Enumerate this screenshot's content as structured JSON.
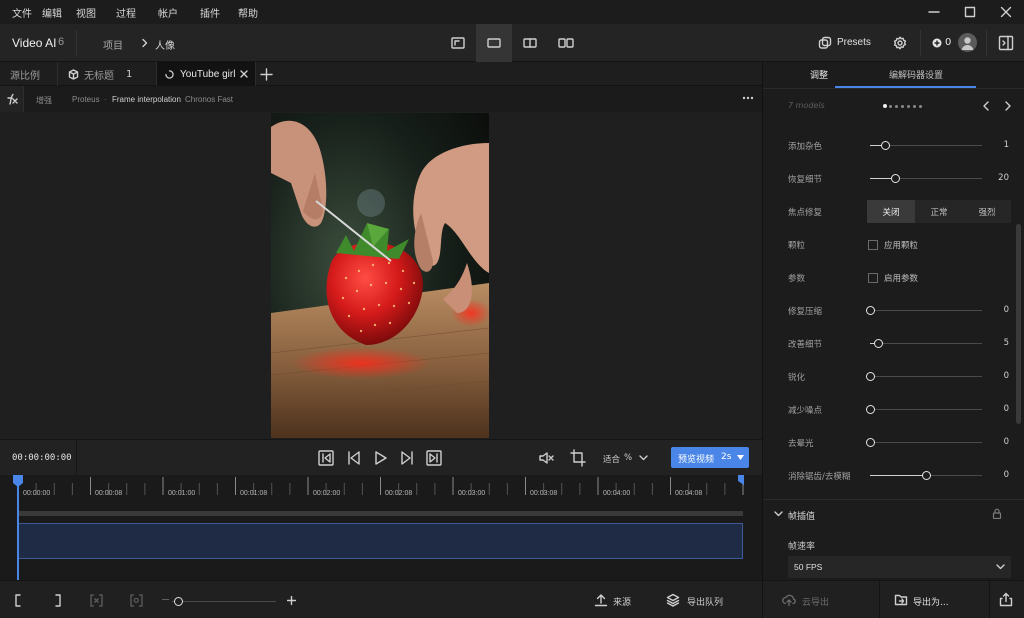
{
  "menu": {
    "items": [
      "文件",
      "编辑",
      "视图",
      "过程",
      "帐户",
      "插件",
      "帮助"
    ]
  },
  "header": {
    "app_name": "Video AI",
    "version": "6",
    "breadcrumb_project": "项目",
    "breadcrumb_current": "人像",
    "presets_label": "Presets",
    "credits": "0"
  },
  "tabs": [
    {
      "label": "源比例"
    },
    {
      "label": "无标题",
      "count": "1"
    },
    {
      "label": "YouTube girl"
    }
  ],
  "fxbar": {
    "enhance": "增强",
    "model": "Proteus",
    "interp": "Frame interpolation",
    "interp_model": "Chronos Fast"
  },
  "transport": {
    "timecode": "00:00:00:00",
    "fit_label": "适合",
    "fit_unit": "%",
    "preview_label": "预览视频",
    "preview_duration": "2s"
  },
  "timeline": {
    "ticks": [
      "00:00:00",
      "00:00:08",
      "00:01:00",
      "00:01:08",
      "00:02:00",
      "00:02:08",
      "00:03:00",
      "00:03:08",
      "00:04:00",
      "00:04:08"
    ]
  },
  "bottom": {
    "source_label": "来源",
    "export_queue_label": "导出队列"
  },
  "right_panel": {
    "tab_adjust": "调整",
    "tab_encoder": "编解码器设置",
    "models_label": "7 models",
    "carousel_dots": 7,
    "carousel_active": 0,
    "sliders_top": [
      {
        "label": "添加杂色",
        "value": "1",
        "fraction": 0.13
      },
      {
        "label": "恢复细节",
        "value": "20",
        "fraction": 0.22
      }
    ],
    "focus_label": "焦点修复",
    "focus_options": [
      "关闭",
      "正常",
      "强烈"
    ],
    "focus_selected": 0,
    "grain": {
      "label": "颗粒",
      "checkbox": "应用颗粒"
    },
    "params": {
      "label": "参数",
      "checkbox": "启用参数"
    },
    "sliders_bottom": [
      {
        "label": "修复压缩",
        "value": "0",
        "fraction": 0.0
      },
      {
        "label": "改善细节",
        "value": "5",
        "fraction": 0.07
      },
      {
        "label": "锐化",
        "value": "0",
        "fraction": 0.0
      },
      {
        "label": "减少噪点",
        "value": "0",
        "fraction": 0.0
      },
      {
        "label": "去晕光",
        "value": "0",
        "fraction": 0.0
      },
      {
        "label": "消除锯齿/去模糊",
        "value": "0",
        "fraction": 0.5
      }
    ],
    "frame_interp_title": "帧插值",
    "frame_rate_label": "帧速率",
    "frame_rate_value": "50 FPS",
    "cloud_export": "云导出",
    "export_as": "导出为..."
  }
}
